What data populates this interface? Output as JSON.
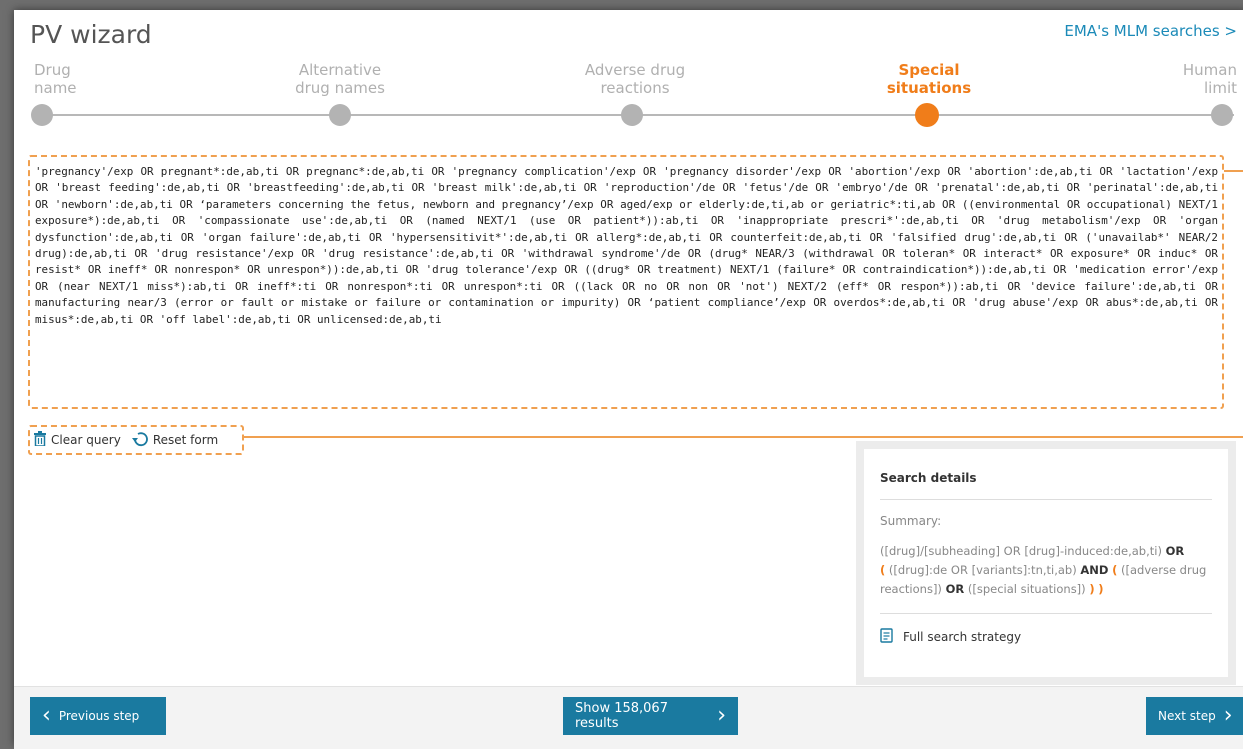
{
  "header": {
    "title": "PV wizard",
    "ema_link": "EMA's MLM searches >"
  },
  "steps": [
    {
      "line1": "Drug",
      "line2": "name"
    },
    {
      "line1": "Alternative",
      "line2": "drug names"
    },
    {
      "line1": "Adverse drug",
      "line2": "reactions"
    },
    {
      "line1": "Special",
      "line2": "situations"
    },
    {
      "line1": "Human",
      "line2": "limit"
    }
  ],
  "active_step": "Special situations",
  "query": "'pregnancy'/exp OR pregnant*:de,ab,ti OR pregnanc*:de,ab,ti OR 'pregnancy complication'/exp OR 'pregnancy disorder'/exp OR 'abortion'/exp OR 'abortion':de,ab,ti OR 'lactation'/exp OR 'breast feeding':de,ab,ti OR 'breastfeeding':de,ab,ti OR 'breast milk':de,ab,ti OR 'reproduction'/de OR 'fetus'/de OR 'embryo'/de OR 'prenatal':de,ab,ti OR 'perinatal':de,ab,ti OR 'newborn':de,ab,ti OR ‘parameters concerning the fetus, newborn and pregnancy’/exp OR aged/exp or elderly:de,ti,ab or geriatric*:ti,ab OR ((environmental OR occupational) NEXT/1 exposure*):de,ab,ti OR 'compassionate use':de,ab,ti OR (named NEXT/1 (use OR patient*)):ab,ti OR 'inappropriate prescri*':de,ab,ti OR 'drug metabolism'/exp OR 'organ dysfunction':de,ab,ti OR 'organ failure':de,ab,ti OR 'hypersensitivit*':de,ab,ti OR allerg*:de,ab,ti OR counterfeit:de,ab,ti OR 'falsified drug':de,ab,ti OR ('unavailab*' NEAR/2 drug):de,ab,ti OR 'drug resistance'/exp OR 'drug resistance':de,ab,ti OR 'withdrawal syndrome'/de OR (drug* NEAR/3 (withdrawal OR toleran* OR interact* OR exposure* OR induc* OR resist* OR ineff* OR nonrespon* OR unrespon*)):de,ab,ti OR 'drug tolerance'/exp OR ((drug* OR treatment) NEXT/1 (failure* OR contraindication*)):de,ab,ti OR 'medication error'/exp OR (near NEXT/1 miss*):ab,ti OR ineff*:ti OR nonrespon*:ti OR unrespon*:ti OR ((lack OR no OR non OR 'not') NEXT/2 (eff* OR respon*)):ab,ti OR 'device failure':de,ab,ti OR manufacturing near/3 (error or fault or mistake or failure or contamination or impurity) OR ‘patient compliance’/exp OR overdos*:de,ab,ti OR 'drug abuse'/exp OR abus*:de,ab,ti OR misus*:de,ab,ti OR 'off label':de,ab,ti OR unlicensed:de,ab,ti",
  "actions": {
    "clear": "Clear query",
    "reset": "Reset form"
  },
  "details": {
    "title": "Search details",
    "summary_label": "Summary:",
    "summary_p1": "([drug]/[subheading] OR [drug]-induced:de,ab,ti) ",
    "summary_or1": "OR",
    "summary_open1": "(",
    "summary_p2": " ([drug]:de OR [variants]:tn,ti,ab) ",
    "summary_and": "AND",
    "summary_open2": "(",
    "summary_p3": " ([adverse drug reactions]) ",
    "summary_or2": "OR",
    "summary_p4": " ([special situations]) ",
    "summary_close1": ")",
    "summary_close2": ")",
    "full_strategy": "Full search strategy"
  },
  "footer": {
    "prev": "Previous step",
    "show": "Show 158,067 results",
    "next": "Next step"
  },
  "colors": {
    "accent": "#f07d1a",
    "primary_button": "#1a7aa0",
    "link": "#1b8ab8"
  }
}
